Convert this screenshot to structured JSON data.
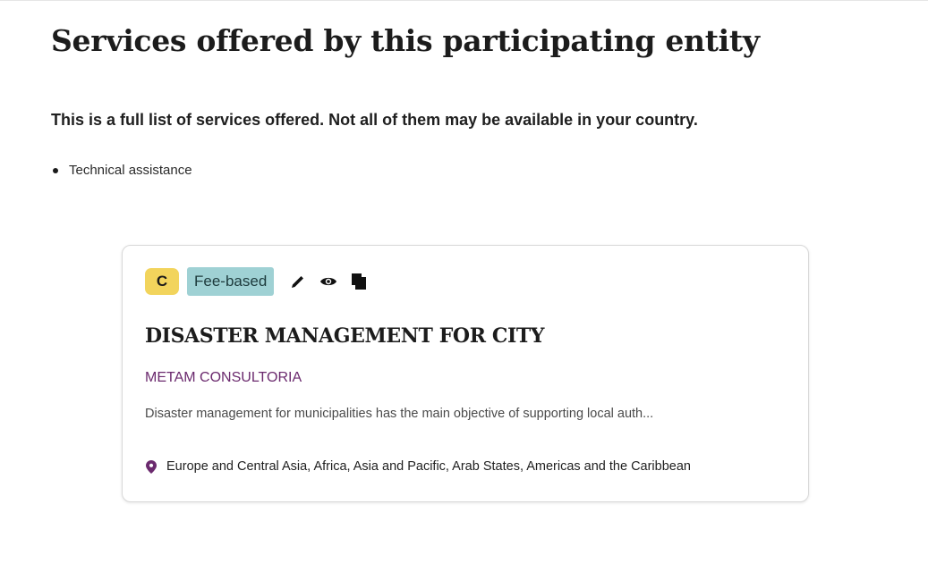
{
  "page": {
    "title": "Services offered by this participating entity",
    "intro": "This is a full list of services offered. Not all of them may be available in your country."
  },
  "services": [
    "Technical assistance"
  ],
  "card": {
    "grade_badge": "C",
    "fee_badge": "Fee-based",
    "actions": [
      "pencil-icon",
      "eye-icon",
      "copy-icon"
    ],
    "title": "DISASTER MANAGEMENT FOR CITY",
    "provider": "METAM CONSULTORIA",
    "description": "Disaster management for municipalities has the main objective of supporting local auth...",
    "regions": "Europe and Central Asia, Africa, Asia and Pacific, Arab States, Americas and the Caribbean"
  },
  "colors": {
    "grade_badge_bg": "#f2d45c",
    "fee_badge_bg": "#9fd1d4",
    "provider_text": "#6b2a6e",
    "location_pin": "#6b2a6e"
  }
}
